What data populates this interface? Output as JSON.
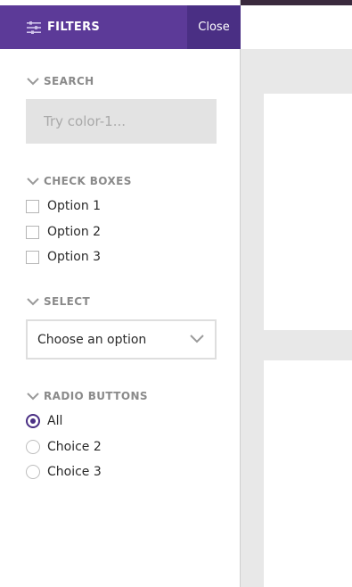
{
  "drawer": {
    "title": "FILTERS",
    "close_label": "Close",
    "accent_color": "#5c3a98"
  },
  "search": {
    "heading": "SEARCH",
    "placeholder": "Try color-1..."
  },
  "checkboxes": {
    "heading": "CHECK BOXES",
    "options": [
      {
        "label": "Option 1",
        "checked": false
      },
      {
        "label": "Option 2",
        "checked": false
      },
      {
        "label": "Option 3",
        "checked": false
      }
    ]
  },
  "select": {
    "heading": "SELECT",
    "value": "Choose an option"
  },
  "radios": {
    "heading": "RADIO BUTTONS",
    "options": [
      {
        "label": "All",
        "checked": true
      },
      {
        "label": "Choice 2",
        "checked": false
      },
      {
        "label": "Choice 3",
        "checked": false
      }
    ]
  }
}
